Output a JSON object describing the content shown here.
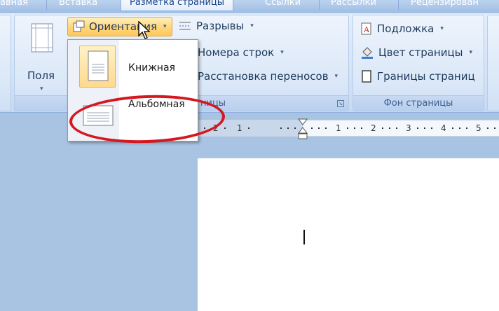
{
  "tabs": [
    {
      "label": "авная",
      "active": false
    },
    {
      "label": "Вставка",
      "active": false
    },
    {
      "label": "Разметка страницы",
      "active": true
    },
    {
      "label": "Ссылки",
      "active": false
    },
    {
      "label": "Рассылки",
      "active": false
    },
    {
      "label": "Рецензирован",
      "active": false
    }
  ],
  "ribbon": {
    "fields_label": "Поля",
    "orientation_label": "Ориентация",
    "breaks_label": "Разрывы",
    "line_numbers_label": "Номера строк",
    "hyphenation_label": "Расстановка переносов",
    "page_setup_group_label": "ницы",
    "watermark_label": "Подложка",
    "page_color_label": "Цвет страницы",
    "page_borders_label": "Границы страниц",
    "page_background_group_label": "Фон страницы"
  },
  "orientation_menu": {
    "portrait_label": "Книжная",
    "landscape_label": "Альбомная",
    "selected": "portrait"
  },
  "ruler": {
    "numbers": [
      "2",
      "1",
      "1",
      "2",
      "3",
      "4",
      "5"
    ]
  },
  "colors": {
    "annotation": "#d41820",
    "selected_highlight": "#ffd57a"
  }
}
